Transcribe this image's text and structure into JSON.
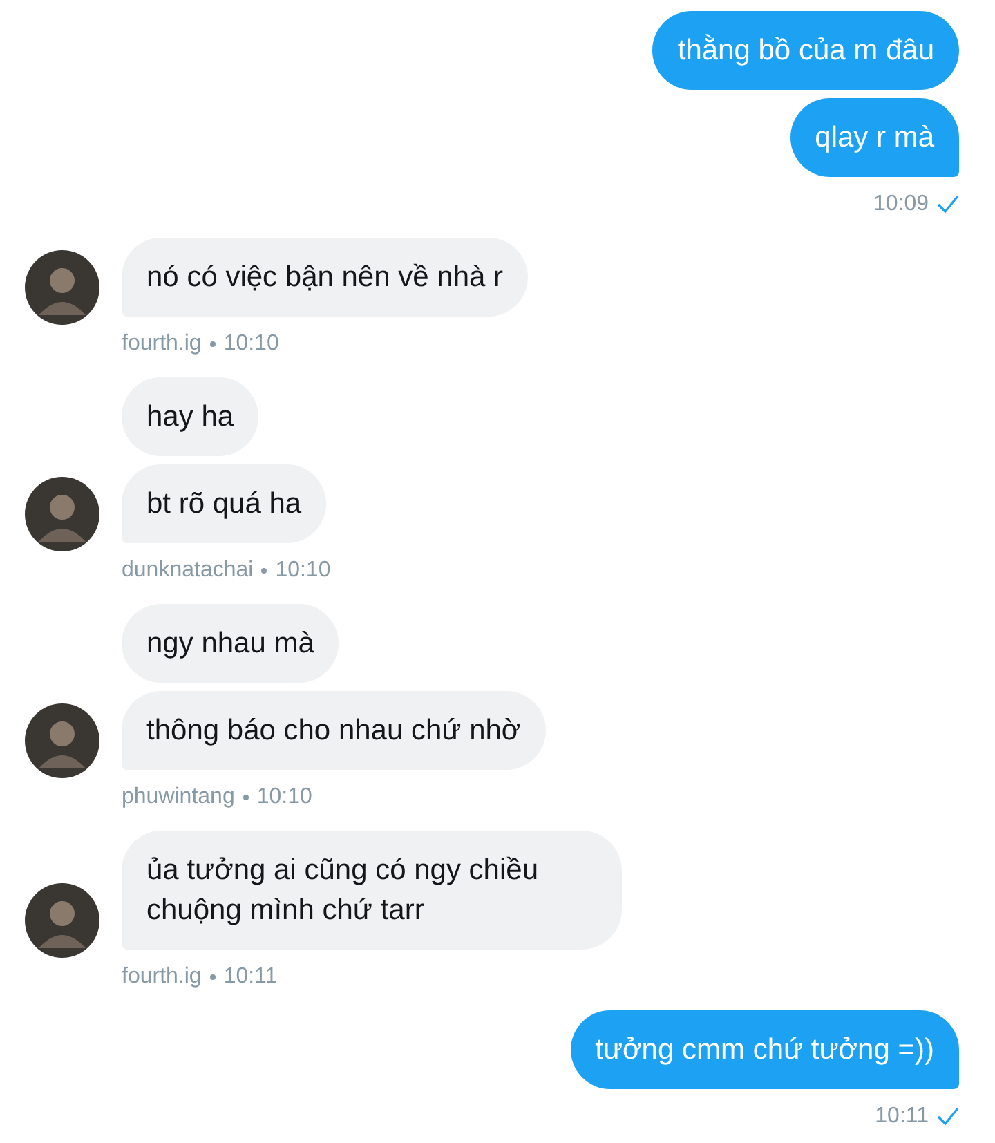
{
  "conversation": [
    {
      "outgoing": true,
      "messages": [
        "thằng bồ của m đâu",
        "qlay r mà"
      ],
      "time": "10:09",
      "read": true
    },
    {
      "outgoing": false,
      "messages": [
        "nó có việc bận nên về nhà r"
      ],
      "sender": "fourth.ig",
      "time": "10:10"
    },
    {
      "outgoing": false,
      "messages": [
        "hay ha",
        "bt rõ quá ha"
      ],
      "sender": "dunknatachai",
      "time": "10:10"
    },
    {
      "outgoing": false,
      "messages": [
        "ngy nhau mà",
        "thông báo cho nhau chứ nhờ"
      ],
      "sender": "phuwintang",
      "time": "10:10"
    },
    {
      "outgoing": false,
      "messages": [
        "ủa tưởng ai cũng có ngy chiều chuộng mình chứ tarr"
      ],
      "sender": "fourth.ig",
      "time": "10:11"
    },
    {
      "outgoing": true,
      "messages": [
        "tưởng cmm chứ tưởng =))"
      ],
      "time": "10:11",
      "read": true
    }
  ]
}
